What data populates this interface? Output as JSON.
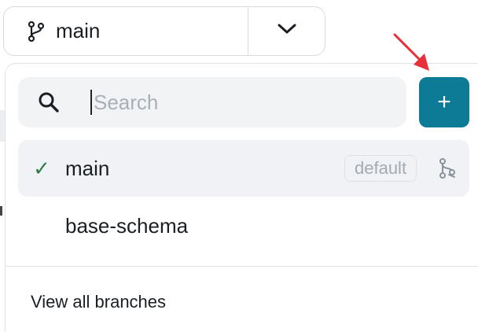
{
  "branch_selector": {
    "current_branch": "main",
    "branch_icon": "git-branch-icon",
    "toggle_icon": "chevron-down-icon"
  },
  "dropdown": {
    "search": {
      "placeholder": "Search",
      "value": "",
      "icon": "search-icon"
    },
    "add_button": {
      "label": "+",
      "icon": "plus-icon",
      "color": "#0d7a96"
    },
    "branches": [
      {
        "name": "main",
        "selected": true,
        "badge": "default",
        "check": "✓",
        "action_icon": "git-merge-icon"
      },
      {
        "name": "base-schema",
        "selected": false
      }
    ],
    "view_all_label": "View all branches"
  },
  "colors": {
    "accent": "#0d7a96",
    "check": "#2e7d4a",
    "annotation_arrow": "#e8303a"
  }
}
